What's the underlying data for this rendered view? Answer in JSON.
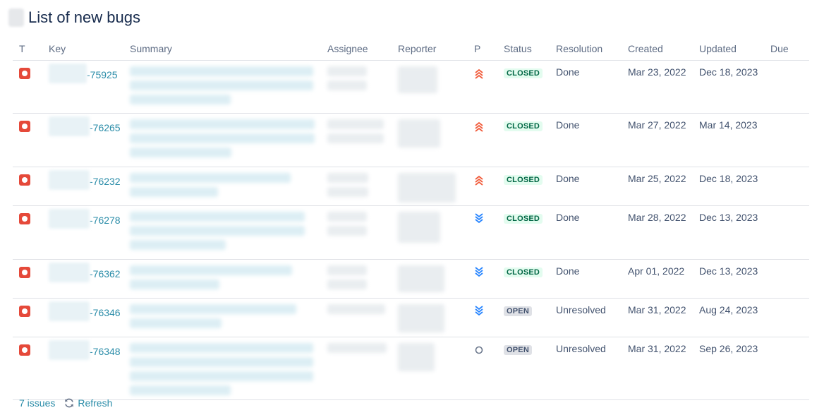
{
  "page": {
    "title": "List of new bugs"
  },
  "columns": [
    "T",
    "Key",
    "Summary",
    "Assignee",
    "Reporter",
    "P",
    "Status",
    "Resolution",
    "Created",
    "Updated",
    "Due"
  ],
  "issues": [
    {
      "key_suffix": "-75925",
      "priority": "highest",
      "status": "CLOSED",
      "resolution": "Done",
      "created": "Mar 23, 2022",
      "updated": "Dec 18, 2023"
    },
    {
      "key_suffix": "-76265",
      "priority": "highest",
      "status": "CLOSED",
      "resolution": "Done",
      "created": "Mar 27, 2022",
      "updated": "Mar 14, 2023"
    },
    {
      "key_suffix": "-76232",
      "priority": "highest",
      "status": "CLOSED",
      "resolution": "Done",
      "created": "Mar 25, 2022",
      "updated": "Dec 18, 2023"
    },
    {
      "key_suffix": "-76278",
      "priority": "lowest",
      "status": "CLOSED",
      "resolution": "Done",
      "created": "Mar 28, 2022",
      "updated": "Dec 13, 2023"
    },
    {
      "key_suffix": "-76362",
      "priority": "lowest",
      "status": "CLOSED",
      "resolution": "Done",
      "created": "Apr 01, 2022",
      "updated": "Dec 13, 2023"
    },
    {
      "key_suffix": "-76346",
      "priority": "lowest",
      "status": "OPEN",
      "resolution": "Unresolved",
      "created": "Mar 31, 2022",
      "updated": "Aug 24, 2023"
    },
    {
      "key_suffix": "-76348",
      "priority": "none",
      "status": "OPEN",
      "resolution": "Unresolved",
      "created": "Mar 31, 2022",
      "updated": "Sep 26, 2023"
    }
  ],
  "footer": {
    "count_label": "7 issues",
    "refresh_label": "Refresh"
  },
  "icons": {
    "type": "bug-icon",
    "priority_highest": "double-chevron-up-icon",
    "priority_lowest": "double-chevron-down-icon",
    "priority_none": "circle-icon",
    "refresh": "refresh-icon"
  },
  "colors": {
    "accent_link": "#2a8ca8",
    "bug": "#e5493a",
    "priority_high": "#f15b3b",
    "priority_low": "#2684ff",
    "closed_bg": "#e3fcef",
    "closed_text": "#006644",
    "open_bg": "#dfe1e6",
    "open_text": "#42526e"
  }
}
